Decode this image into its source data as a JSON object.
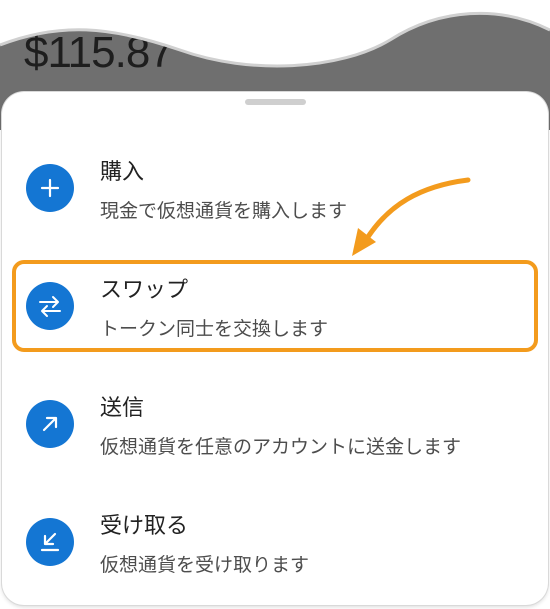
{
  "balance": {
    "text": "$115.87"
  },
  "menu": {
    "items": [
      {
        "title": "購入",
        "description": "現金で仮想通貨を購入します",
        "icon": "plus-icon"
      },
      {
        "title": "スワップ",
        "description": "トークン同士を交換します",
        "icon": "swap-arrows-icon"
      },
      {
        "title": "送信",
        "description": "仮想通貨を任意のアカウントに送金します",
        "icon": "arrow-up-right-icon"
      },
      {
        "title": "受け取る",
        "description": "仮想通貨を受け取ります",
        "icon": "arrow-down-left-tray-icon"
      }
    ]
  },
  "colors": {
    "icon_bg": "#1476d3",
    "highlight": "#f39b1d",
    "backdrop": "#6f6f6f"
  }
}
